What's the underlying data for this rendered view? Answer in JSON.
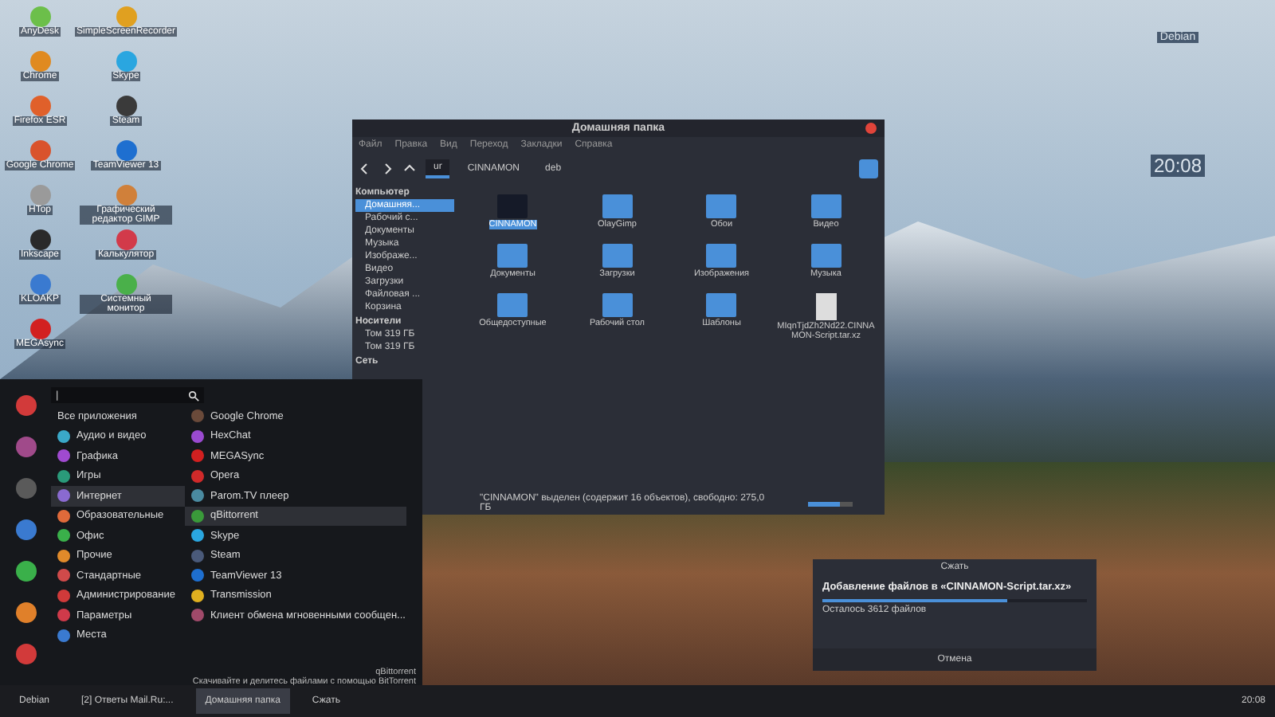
{
  "desktop_icons": [
    {
      "label": "AnyDesk",
      "color": "#6cbf4a"
    },
    {
      "label": "SimpleScreenRecorder",
      "color": "#e0a020"
    },
    {
      "label": "Chrome",
      "color": "#e08a20"
    },
    {
      "label": "Skype",
      "color": "#2aa6e0"
    },
    {
      "label": "Firefox ESR",
      "color": "#e0602a"
    },
    {
      "label": "Steam",
      "color": "#3a3a3a"
    },
    {
      "label": "Google Chrome",
      "color": "#d9532c"
    },
    {
      "label": "TeamViewer 13",
      "color": "#1e6fd0"
    },
    {
      "label": "HTop",
      "color": "#9a9a9a"
    },
    {
      "label": "Графический редактор GIMP",
      "color": "#d0803a"
    },
    {
      "label": "Inkscape",
      "color": "#2a2a2a"
    },
    {
      "label": "Калькулятор",
      "color": "#d23a4a"
    },
    {
      "label": "KLOAKP",
      "color": "#3a7ad0"
    },
    {
      "label": "Системный монитор",
      "color": "#4ab04a"
    },
    {
      "label": "MEGAsync",
      "color": "#d22020"
    }
  ],
  "conky": {
    "title": "Debian",
    "clock": "20:08"
  },
  "file_manager": {
    "title": "Домашняя папка",
    "menu": [
      "Файл",
      "Правка",
      "Вид",
      "Переход",
      "Закладки",
      "Справка"
    ],
    "path": [
      {
        "label": "ur",
        "selected": true
      },
      {
        "label": "CINNAMON",
        "selected": false
      },
      {
        "label": "deb",
        "selected": false
      }
    ],
    "sidebar": [
      {
        "heading": "Компьютер",
        "items": [
          {
            "label": "Домашняя...",
            "selected": true
          },
          {
            "label": "Рабочий с...",
            "selected": false
          },
          {
            "label": "Документы",
            "selected": false
          },
          {
            "label": "Музыка",
            "selected": false
          },
          {
            "label": "Изображе...",
            "selected": false
          },
          {
            "label": "Видео",
            "selected": false
          },
          {
            "label": "Загрузки",
            "selected": false
          },
          {
            "label": "Файловая ...",
            "selected": false
          },
          {
            "label": "Корзина",
            "selected": false
          }
        ]
      },
      {
        "heading": "Носители",
        "items": [
          {
            "label": "Том 319 ГБ",
            "selected": false
          },
          {
            "label": "Том 319 ГБ",
            "selected": false
          }
        ]
      },
      {
        "heading": "Сеть"
      }
    ],
    "items": [
      {
        "label": "CINNAMON",
        "kind": "dark",
        "selected": true
      },
      {
        "label": "OlayGimp",
        "kind": "folder",
        "selected": false
      },
      {
        "label": "Обои",
        "kind": "folder",
        "selected": false
      },
      {
        "label": "Видео",
        "kind": "folder",
        "selected": false
      },
      {
        "label": "Документы",
        "kind": "folder",
        "selected": false
      },
      {
        "label": "Загрузки",
        "kind": "folder",
        "selected": false
      },
      {
        "label": "Изображения",
        "kind": "folder",
        "selected": false
      },
      {
        "label": "Музыка",
        "kind": "folder",
        "selected": false
      },
      {
        "label": "Общедоступные",
        "kind": "folder",
        "selected": false
      },
      {
        "label": "Рабочий стол",
        "kind": "folder",
        "selected": false
      },
      {
        "label": "Шаблоны",
        "kind": "folder",
        "selected": false
      },
      {
        "label": "MIqnTjdZh2Nd22.CINNAMON-Script.tar.xz",
        "kind": "file",
        "selected": false
      }
    ],
    "status": "\"CINNAMON\" выделен (содержит 16 объектов), свободно: 275,0 ГБ",
    "zoom_level": {
      "level": 0.7
    }
  },
  "app_menu": {
    "search": {
      "value": "|"
    },
    "categories": [
      {
        "label": "Все приложения",
        "selected": false
      },
      {
        "label": "Аудио и видео",
        "color": "#3aa8c8",
        "selected": false
      },
      {
        "label": "Графика",
        "color": "#a04ad0",
        "selected": false
      },
      {
        "label": "Игры",
        "color": "#2a9a7a",
        "selected": false
      },
      {
        "label": "Интернет",
        "color": "#8a6ad0",
        "selected": true
      },
      {
        "label": "Образовательные",
        "color": "#e06a3a",
        "selected": false
      },
      {
        "label": "Офис",
        "color": "#3ab04a",
        "selected": false
      },
      {
        "label": "Прочие",
        "color": "#e08a2a",
        "selected": false
      },
      {
        "label": "Стандартные",
        "color": "#d04a4a",
        "selected": false
      },
      {
        "label": "Администрирование",
        "color": "#d03a3a",
        "selected": false
      },
      {
        "label": "Параметры",
        "color": "#d03a4a",
        "selected": false
      },
      {
        "label": "Места",
        "color": "#3a7ad0",
        "selected": false
      }
    ],
    "apps": [
      {
        "label": "Google Chrome",
        "color": "#6a4a3a",
        "selected": false
      },
      {
        "label": "HexChat",
        "color": "#9a4ad0",
        "selected": false
      },
      {
        "label": "MEGASync",
        "color": "#d22020",
        "selected": false
      },
      {
        "label": "Opera",
        "color": "#d02a2a",
        "selected": false
      },
      {
        "label": "Parom.TV плеер",
        "color": "#4a8aa0",
        "selected": false
      },
      {
        "label": "qBittorrent",
        "color": "#3a9a3a",
        "selected": true
      },
      {
        "label": "Skype",
        "color": "#2aa6e0",
        "selected": false
      },
      {
        "label": "Steam",
        "color": "#4a5a7a",
        "selected": false
      },
      {
        "label": "TeamViewer 13",
        "color": "#1e6fd0",
        "selected": false
      },
      {
        "label": "Transmission",
        "color": "#e0b020",
        "selected": false
      },
      {
        "label": "Клиент обмена мгновенными сообщен...",
        "color": "#a04a6a",
        "selected": false
      }
    ],
    "description": {
      "title": "qBittorrent",
      "text": "Скачивайте и делитесь файлами с помощью BitTorrent"
    }
  },
  "compress_dialog": {
    "title": "Сжать",
    "heading": "Добавление файлов в «CINNAMON-Script.tar.xz»",
    "progress": {
      "level": 0.7
    },
    "remaining": "Осталось 3612 файлов",
    "cancel": "Отмена"
  },
  "taskbar": {
    "start": "Debian",
    "windows": [
      {
        "label": "[2] Ответы Mail.Ru:...",
        "selected": false
      },
      {
        "label": "Домашняя папка",
        "selected": true
      },
      {
        "label": "Сжать",
        "selected": false
      }
    ],
    "clock": "20:08"
  }
}
